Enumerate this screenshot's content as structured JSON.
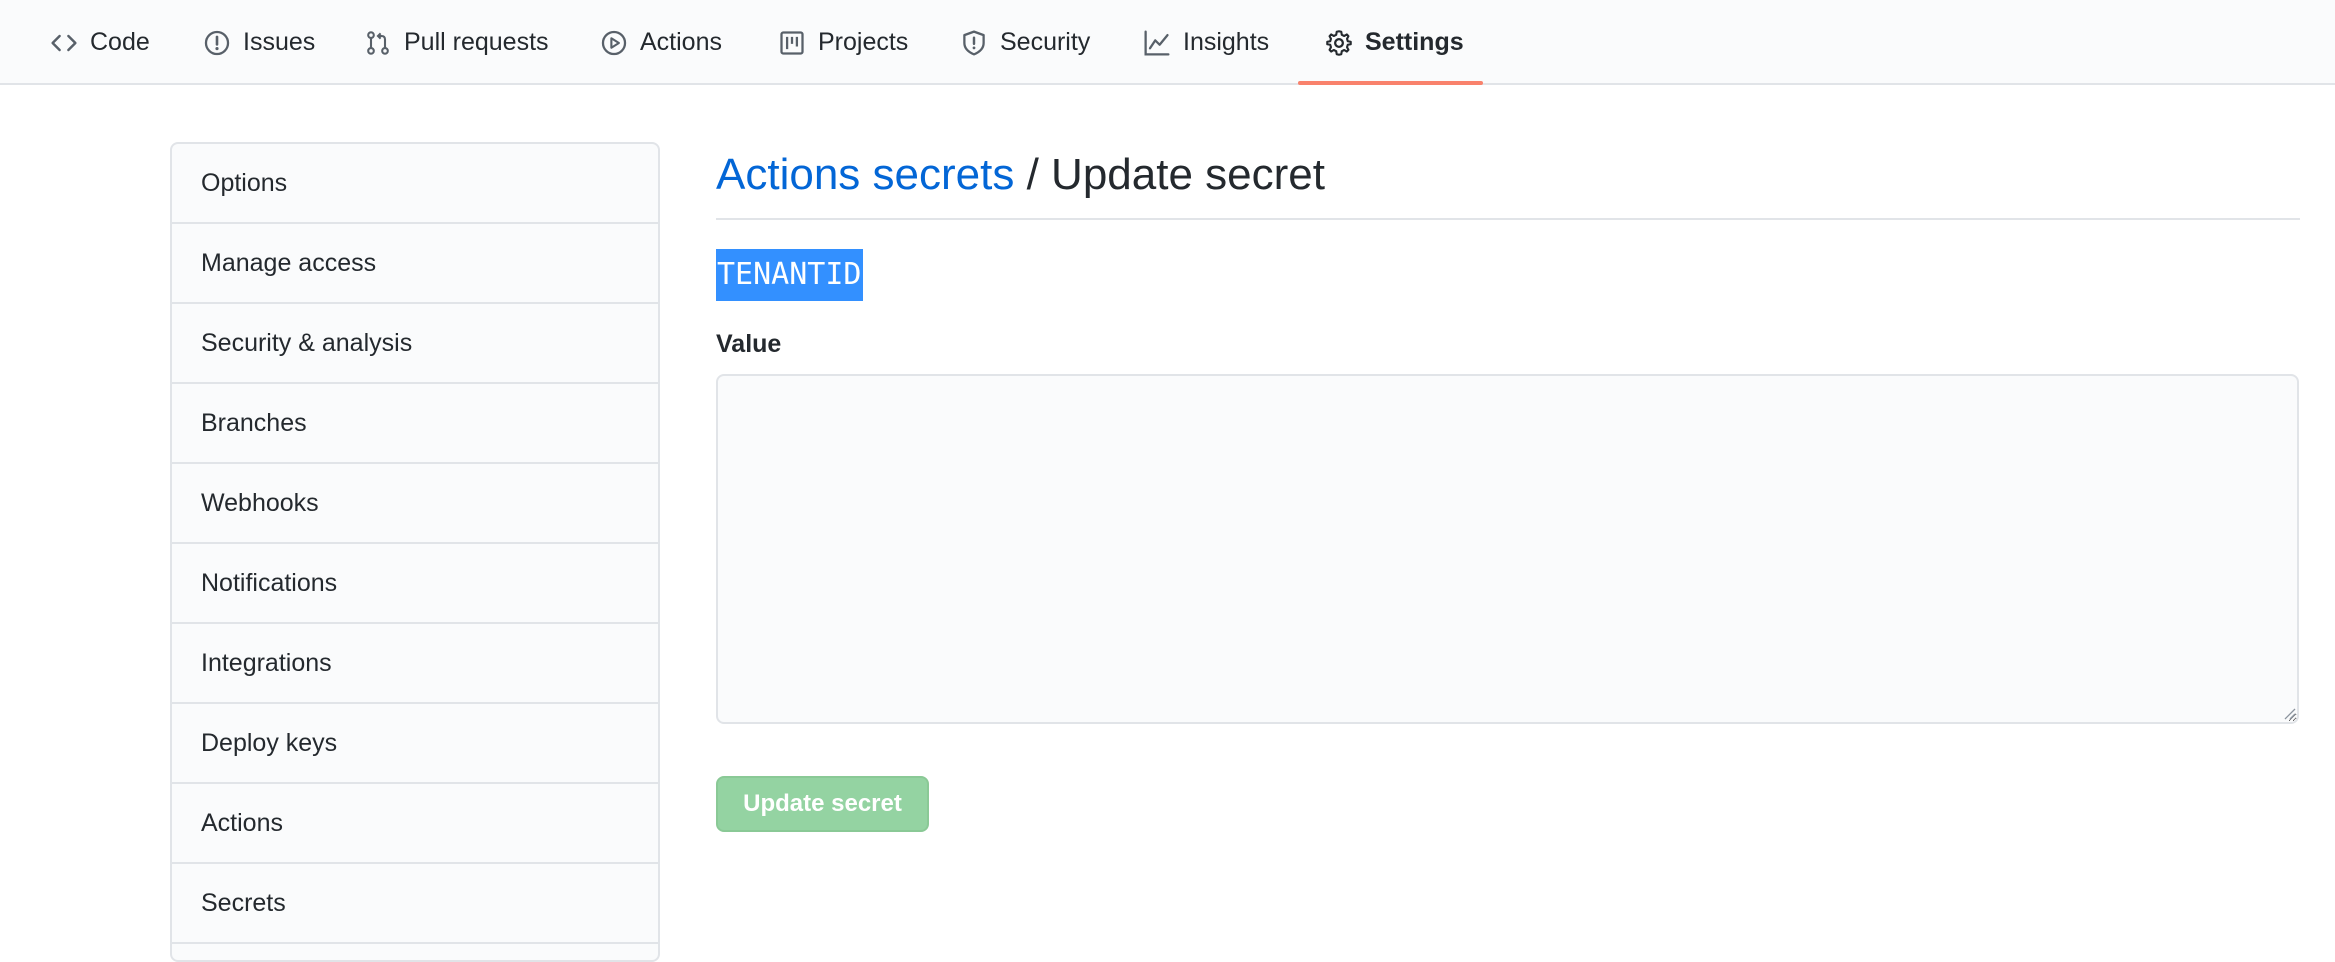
{
  "nav": {
    "tabs": [
      {
        "label": "Code",
        "icon": "code-icon"
      },
      {
        "label": "Issues",
        "icon": "issue-opened-icon"
      },
      {
        "label": "Pull requests",
        "icon": "git-pull-request-icon"
      },
      {
        "label": "Actions",
        "icon": "play-icon"
      },
      {
        "label": "Projects",
        "icon": "project-icon"
      },
      {
        "label": "Security",
        "icon": "shield-icon"
      },
      {
        "label": "Insights",
        "icon": "graph-icon"
      },
      {
        "label": "Settings",
        "icon": "gear-icon"
      }
    ],
    "selected": "Settings",
    "accent_color": "#f9826c"
  },
  "sidebar": {
    "items": [
      {
        "label": "Options"
      },
      {
        "label": "Manage access"
      },
      {
        "label": "Security & analysis"
      },
      {
        "label": "Branches"
      },
      {
        "label": "Webhooks"
      },
      {
        "label": "Notifications"
      },
      {
        "label": "Integrations"
      },
      {
        "label": "Deploy keys"
      },
      {
        "label": "Actions"
      },
      {
        "label": "Secrets"
      }
    ]
  },
  "main": {
    "breadcrumb": {
      "link": "Actions secrets",
      "separator": "/",
      "current": "Update secret"
    },
    "secret_name": "TENANTID",
    "value_label": "Value",
    "value_text": "",
    "value_placeholder": "",
    "submit_label": "Update secret",
    "link_color": "#0366d6",
    "button_color": "#94d3a2",
    "selection_color": "#3390ff"
  }
}
